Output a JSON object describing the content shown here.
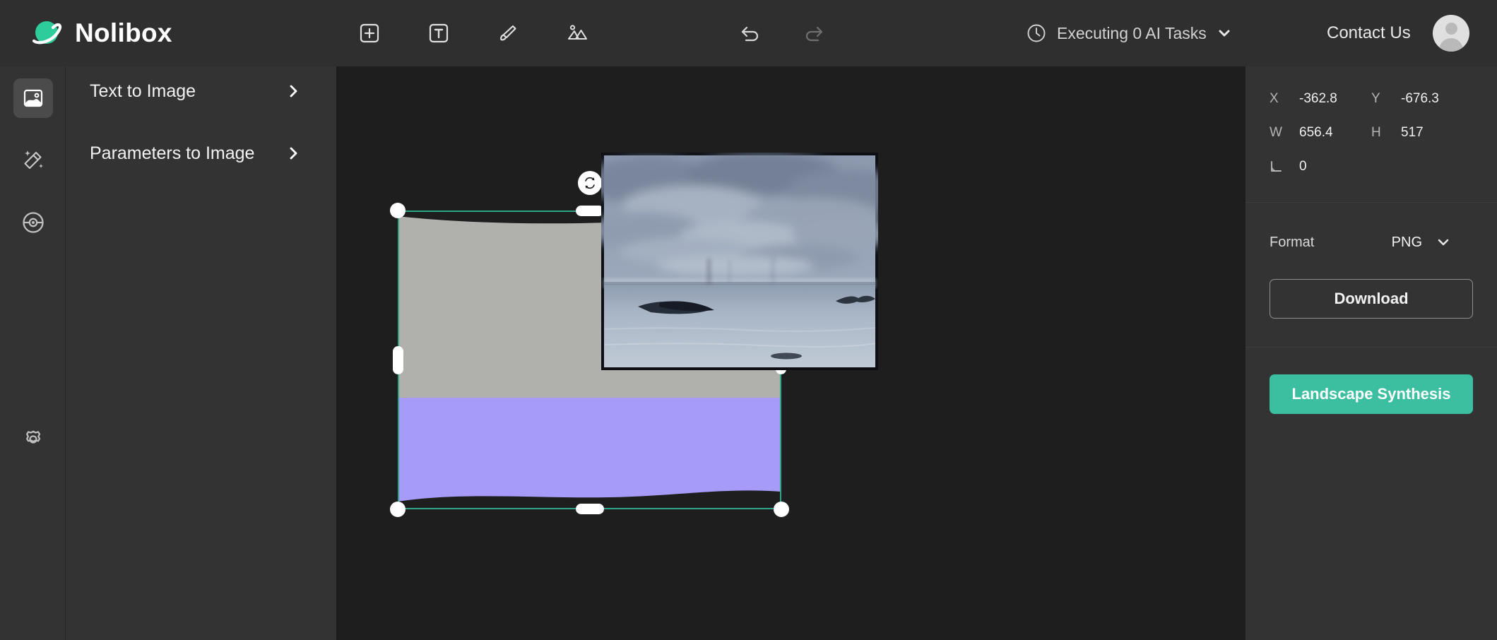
{
  "brand": {
    "name": "Nolibox",
    "logo_icon": "planet-logo-icon",
    "accent": "#2ecc9b"
  },
  "header": {
    "tools": [
      {
        "icon": "add-frame-icon",
        "name": "add-element-button"
      },
      {
        "icon": "text-box-icon",
        "name": "add-text-button"
      },
      {
        "icon": "brush-icon",
        "name": "brush-tool-button"
      },
      {
        "icon": "image-landscape-icon",
        "name": "add-image-button"
      }
    ],
    "history": [
      {
        "icon": "undo-icon",
        "name": "undo-button",
        "enabled": true
      },
      {
        "icon": "redo-icon",
        "name": "redo-button",
        "enabled": false
      }
    ],
    "tasks": {
      "icon": "clock-icon",
      "label": "Executing 0 AI Tasks",
      "chevron": "chevron-down-icon"
    },
    "contact_label": "Contact Us",
    "avatar_icon": "user-avatar-icon"
  },
  "rail": {
    "items": [
      {
        "icon": "image-icon",
        "name": "sidebar-item-image",
        "active": true
      },
      {
        "icon": "magic-wand-icon",
        "name": "sidebar-item-magic",
        "active": false
      },
      {
        "icon": "circle-target-icon",
        "name": "sidebar-item-models",
        "active": false
      }
    ],
    "settings": {
      "icon": "gear-icon",
      "name": "sidebar-item-settings"
    }
  },
  "left_panel": {
    "rows": [
      {
        "label": "Text to Image",
        "chevron": "chevron-right-icon"
      },
      {
        "label": "Parameters to Image",
        "chevron": "chevron-right-icon"
      }
    ]
  },
  "canvas": {
    "selection": {
      "border_color": "#2ea586",
      "rotate_icon": "rotate-icon",
      "mask_sky_color": "#b0b0ac",
      "mask_water_color": "#a79bfa"
    },
    "photo": {
      "name": "seascape-reference-image",
      "alt": "cloudy seascape with driftwood and bird"
    }
  },
  "right_panel": {
    "transform": {
      "x_key": "X",
      "x_value": "-362.8",
      "y_key": "Y",
      "y_value": "-676.3",
      "w_key": "W",
      "w_value": "656.4",
      "h_key": "H",
      "h_value": "517",
      "angle_icon": "angle-icon",
      "angle_value": "0"
    },
    "format": {
      "label": "Format",
      "value": "PNG",
      "chevron": "chevron-down-icon"
    },
    "download_label": "Download",
    "synthesis_label": "Landscape Synthesis",
    "synthesis_color": "#3bbfa0"
  }
}
